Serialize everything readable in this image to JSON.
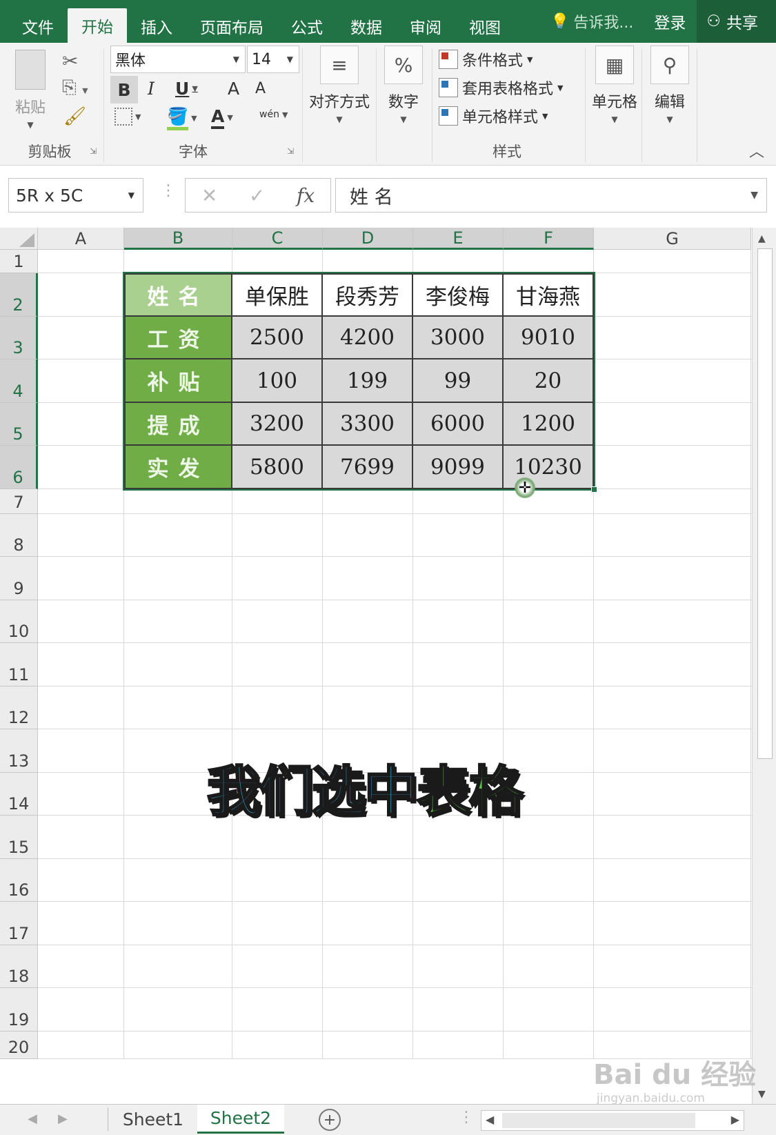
{
  "ribbon_tabs": [
    "文件",
    "开始",
    "插入",
    "页面布局",
    "公式",
    "数据",
    "审阅",
    "视图"
  ],
  "active_tab": "开始",
  "tell_me": "告诉我...",
  "login": "登录",
  "share": "共享",
  "clipboard": {
    "paste": "粘贴",
    "group": "剪贴板"
  },
  "font": {
    "name": "黑体",
    "size": "14",
    "group": "字体",
    "bold": "B",
    "italic": "I",
    "underline": "U",
    "grow": "A",
    "shrink": "A",
    "font_color": "A",
    "phonetic": "wén"
  },
  "alignment": {
    "label": "对齐方式"
  },
  "number": {
    "label": "数字",
    "icon_text": "%"
  },
  "styles": {
    "conditional": "条件格式",
    "table_format": "套用表格格式",
    "cell_style": "单元格样式",
    "group": "样式"
  },
  "cells": {
    "label": "单元格"
  },
  "editing": {
    "label": "编辑"
  },
  "formula_bar": {
    "name_box": "5R x 5C",
    "fx": "fx",
    "content": "姓 名"
  },
  "columns": [
    "A",
    "B",
    "C",
    "D",
    "E",
    "F",
    "G"
  ],
  "rows": [
    "1",
    "2",
    "3",
    "4",
    "5",
    "6",
    "7",
    "8",
    "9",
    "10",
    "11",
    "12",
    "13",
    "14",
    "15",
    "16",
    "17",
    "18",
    "19",
    "20"
  ],
  "table": {
    "header": [
      "姓名",
      "单保胜",
      "段秀芳",
      "李俊梅",
      "甘海燕"
    ],
    "rows": [
      [
        "工资",
        "2500",
        "4200",
        "3000",
        "9010"
      ],
      [
        "补贴",
        "100",
        "199",
        "99",
        "20"
      ],
      [
        "提成",
        "3200",
        "3300",
        "6000",
        "1200"
      ],
      [
        "实发",
        "5800",
        "7699",
        "9099",
        "10230"
      ]
    ]
  },
  "caption": {
    "part1": "我们选中",
    "part2": "表格"
  },
  "sheets": [
    "Sheet1",
    "Sheet2"
  ],
  "active_sheet": "Sheet2",
  "watermark": {
    "brand": "Bai du 经验",
    "url": "jingyan.baidu.com"
  },
  "colors": {
    "accent": "#217346",
    "header_fill": "#a9d08e",
    "label_fill": "#70ad47",
    "number_fill": "#d9d9d9"
  }
}
